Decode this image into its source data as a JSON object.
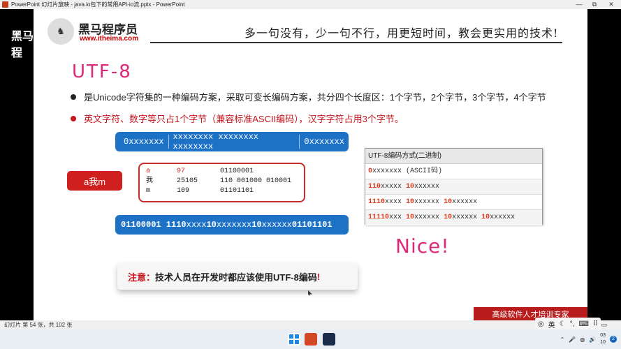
{
  "window": {
    "title": "PowerPoint 幻灯片放映 - java.io包下的常用API-io流.pptx - PowerPoint",
    "controls": [
      "—",
      "⧉",
      "✕"
    ]
  },
  "brand": {
    "left_text": "黑马程",
    "logo_name": "黑马程序员",
    "logo_url": "www.itheima.com",
    "slogan": "多一句没有，少一句不行，用更短时间，教会更实用的技术!"
  },
  "slide": {
    "title": "UTF-8",
    "bullets": [
      "是Unicode字符集的一种编码方案，采取可变长编码方案，共分四个长度区：1个字节，2个字节，3个字节，4个字节",
      "英文字符、数字等只占1个字节（兼容标准ASCII编码），汉字字符占用3个字节。"
    ],
    "format_bar": [
      "0xxxxxxx",
      "xxxxxxxx xxxxxxxx xxxxxxxx",
      "0xxxxxxx"
    ],
    "example_label": "a我m",
    "example_rows": [
      {
        "ch": "a",
        "code": "97",
        "bin": "01100001"
      },
      {
        "ch": "我",
        "code": "25105",
        "bin": "110 001000 010001"
      },
      {
        "ch": "m",
        "code": "109",
        "bin": "01101101"
      }
    ],
    "encoded_bar": [
      {
        "bold": "01100001 1110",
        "rest": "xxxx "
      },
      {
        "bold": "10",
        "rest": "xxxxxxx  "
      },
      {
        "bold": "10",
        "rest": "xxxxxx "
      },
      {
        "bold": "01101101",
        "rest": ""
      }
    ],
    "table": {
      "header": "UTF-8编码方式(二进制)",
      "rows": [
        [
          {
            "b": "0",
            "t": "xxxxxxx  (ASCII码)"
          }
        ],
        [
          {
            "b": "110",
            "t": "xxxxx "
          },
          {
            "b": "10",
            "t": "xxxxxx"
          }
        ],
        [
          {
            "b": "1110",
            "t": "xxxx "
          },
          {
            "b": "10",
            "t": "xxxxxx "
          },
          {
            "b": "10",
            "t": "xxxxxx"
          }
        ],
        [
          {
            "b": "11110",
            "t": "xxx "
          },
          {
            "b": "10",
            "t": "xxxxxx "
          },
          {
            "b": "10",
            "t": "xxxxxx "
          },
          {
            "b": "10",
            "t": "xxxxxx"
          }
        ]
      ]
    },
    "nice": "Nice!",
    "notice_prefix": "注意：",
    "notice_text": "技术人员在开发时都应该使用UTF-8编码",
    "notice_suffix": "!",
    "corner_text": "高级软件人才培训专家"
  },
  "status": {
    "slide_info": "幻灯片 第 54 张，共 102 张",
    "ime_lang": "英"
  },
  "clock": {
    "time": "03",
    "date": "10"
  },
  "notifications": "2"
}
